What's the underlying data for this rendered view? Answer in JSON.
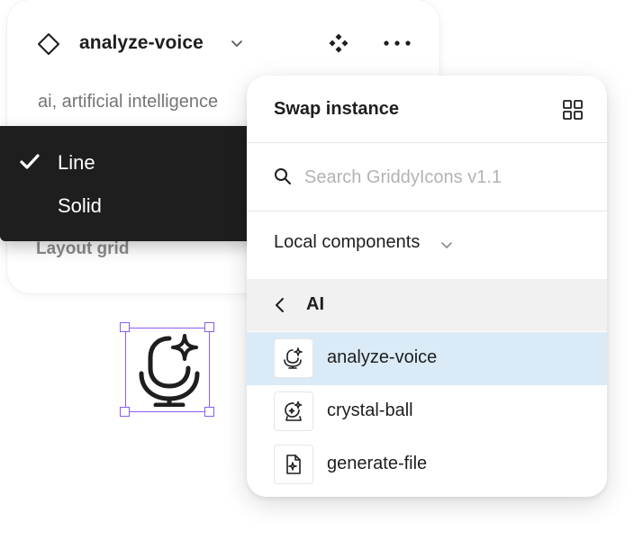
{
  "properties_panel": {
    "component_name": "analyze-voice",
    "description": "ai, artificial intelligence",
    "section_label": "Layout grid"
  },
  "style_menu": {
    "items": [
      {
        "label": "Line",
        "checked": true
      },
      {
        "label": "Solid",
        "checked": false
      }
    ]
  },
  "swap_instance": {
    "title": "Swap instance",
    "search_placeholder": "Search GriddyIcons v1.1",
    "library_label": "Local components",
    "folder_label": "AI",
    "items": [
      {
        "label": "analyze-voice",
        "icon": "analyze-voice-icon",
        "selected": true
      },
      {
        "label": "crystal-ball",
        "icon": "crystal-ball-icon",
        "selected": false
      },
      {
        "label": "generate-file",
        "icon": "generate-file-icon",
        "selected": false
      }
    ]
  },
  "colors": {
    "selection": "#8b5cf6",
    "menu_bg": "#1e1e1e",
    "selected_row": "#daebf7",
    "folder_row": "#f1f1f1"
  }
}
